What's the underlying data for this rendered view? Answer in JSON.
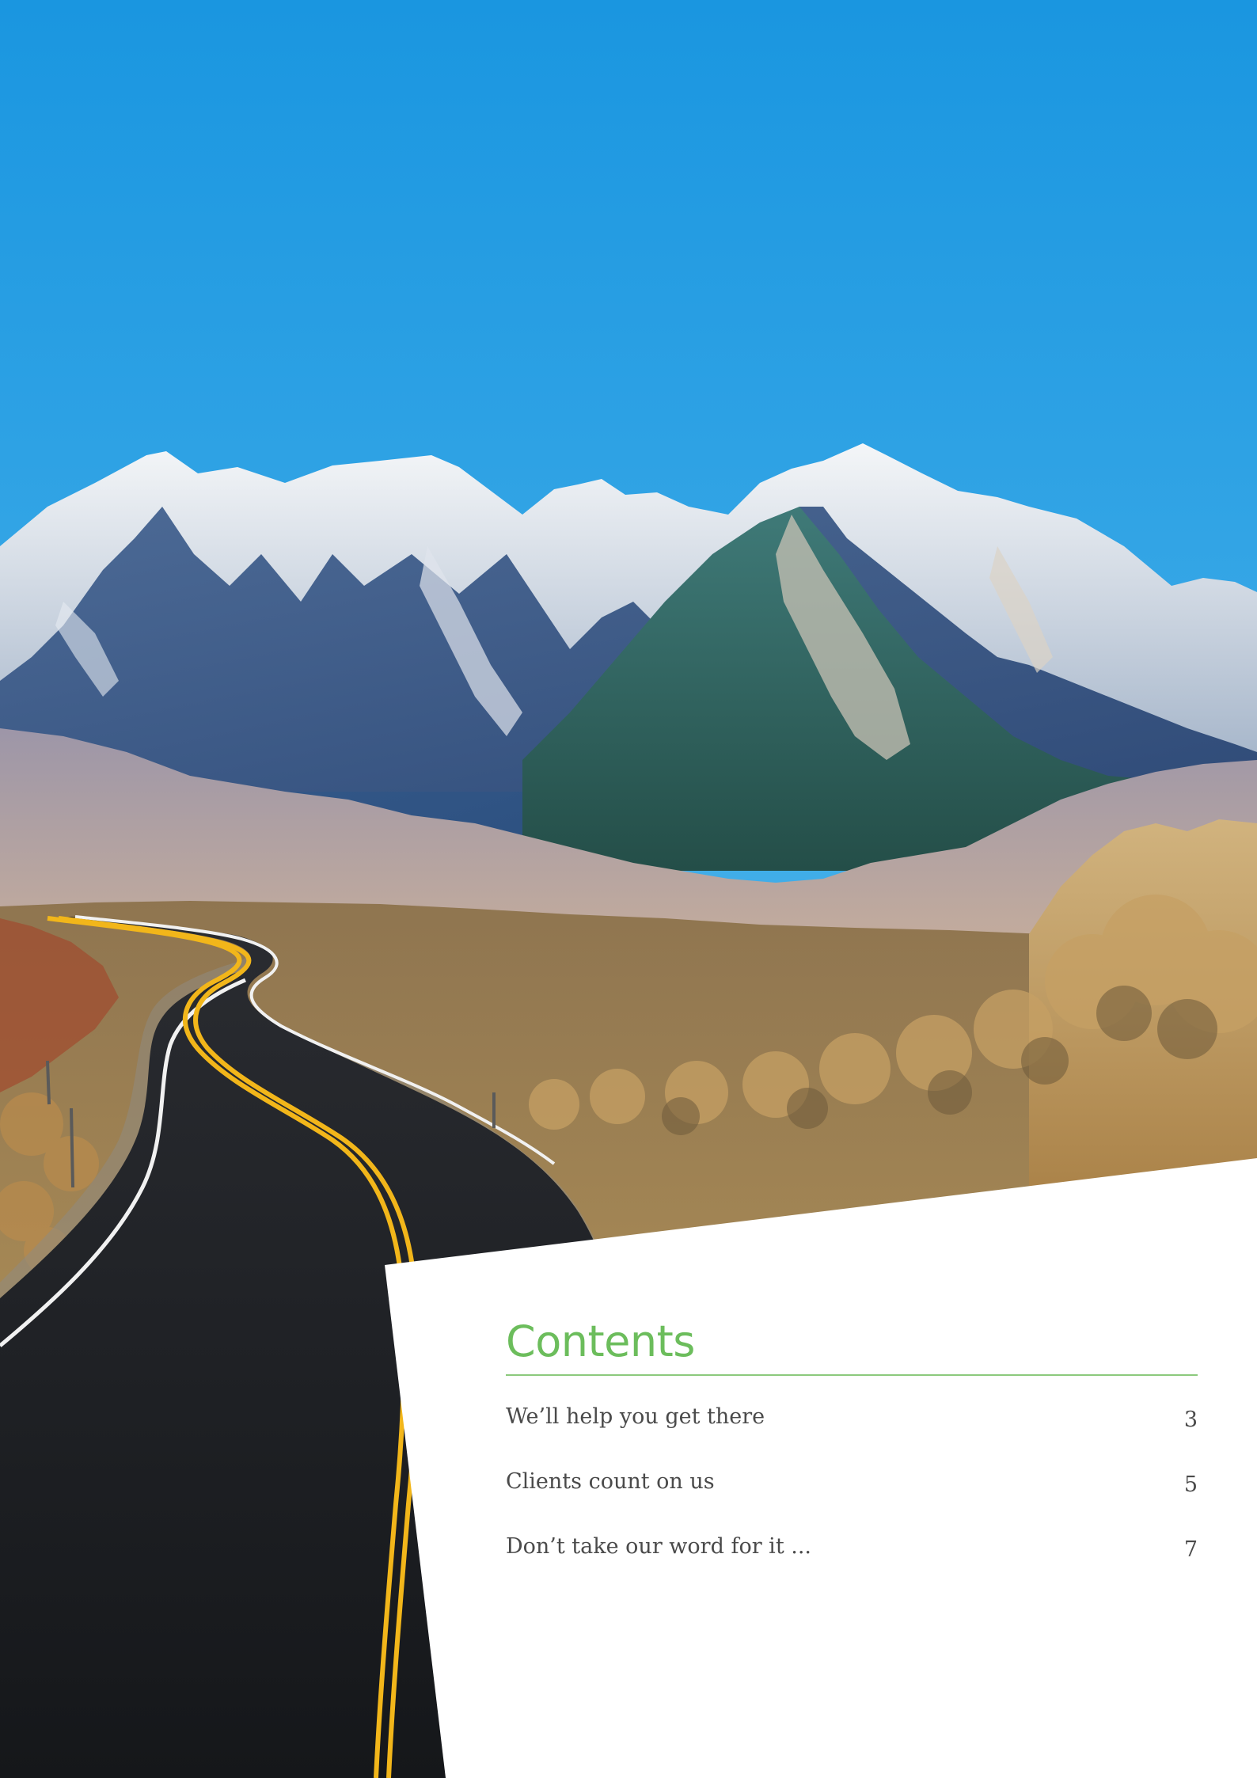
{
  "contents": {
    "title": "Contents",
    "items": [
      {
        "label": "We’ll help you get there",
        "page": "3"
      },
      {
        "label": "Clients count on us",
        "page": "5"
      },
      {
        "label": "Don’t take our word for it ...",
        "page": "7"
      }
    ]
  },
  "colors": {
    "accent_green": "#6cbd5c",
    "sky_blue": "#2b9fe0",
    "text_gray": "#4a4a4a"
  }
}
